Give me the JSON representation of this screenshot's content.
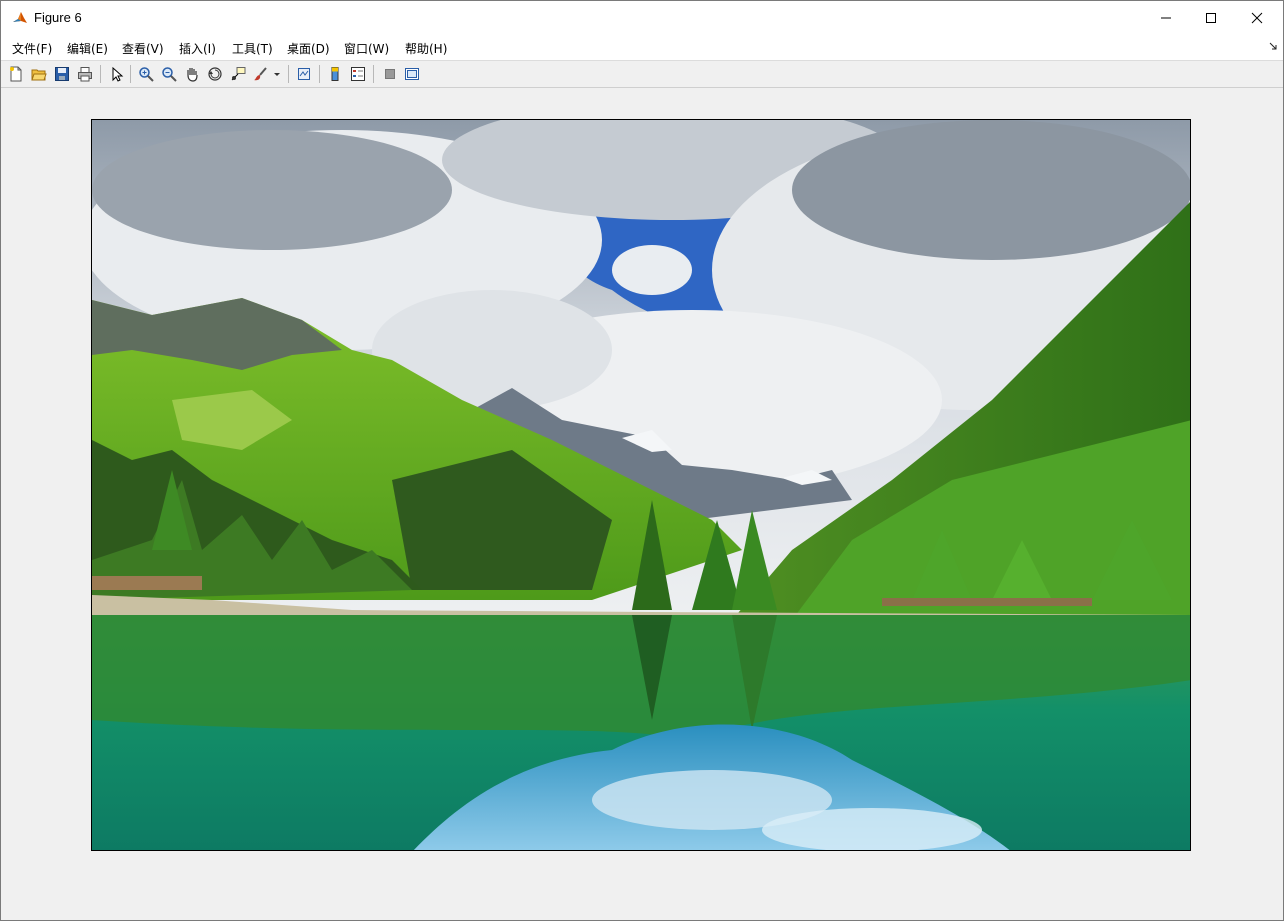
{
  "window": {
    "title": "Figure 6",
    "app_icon": "matlab-icon",
    "controls": [
      "minimize-icon",
      "maximize-icon",
      "close-icon"
    ]
  },
  "menubar": {
    "items": [
      {
        "label": "文件(F)"
      },
      {
        "label": "编辑(E)"
      },
      {
        "label": "查看(V)"
      },
      {
        "label": "插入(I)"
      },
      {
        "label": "工具(T)"
      },
      {
        "label": "桌面(D)"
      },
      {
        "label": "窗口(W)"
      },
      {
        "label": "帮助(H)"
      }
    ],
    "dock_icon": "dock-arrow-icon"
  },
  "toolbar": {
    "buttons": [
      "new-figure-icon",
      "open-file-icon",
      "save-icon",
      "print-icon",
      "select-pointer-icon",
      "zoom-in-icon",
      "zoom-out-icon",
      "pan-hand-icon",
      "rotate-3d-icon",
      "data-cursor-icon",
      "brush-icon",
      "brush-dropdown-icon",
      "link-plot-icon",
      "insert-colorbar-icon",
      "insert-legend-icon",
      "hide-plot-tools-icon",
      "show-plot-tools-icon"
    ]
  },
  "figure": {
    "content": "image-display",
    "colors": {
      "sky": "#7f9ec0",
      "water": "#1a8a6a",
      "forest": "#3f8a22"
    }
  }
}
